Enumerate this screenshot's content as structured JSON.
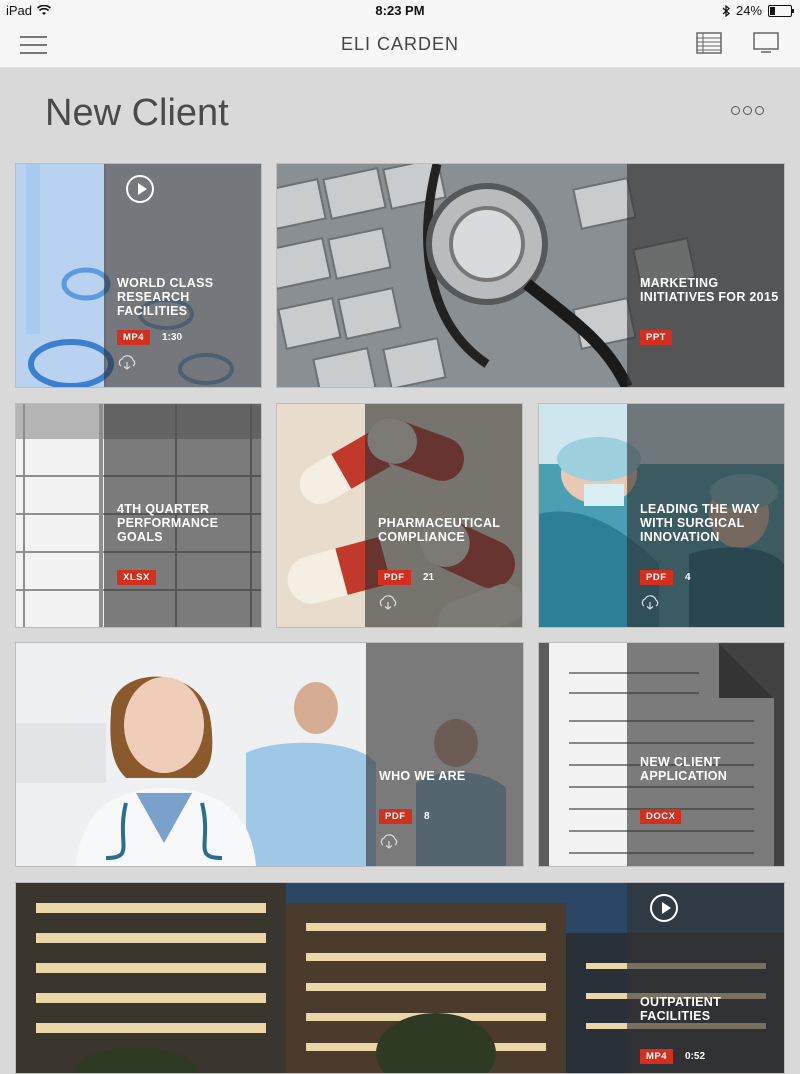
{
  "status_bar": {
    "device": "iPad",
    "time": "8:23 PM",
    "battery": "24%",
    "battery_level": 0.24
  },
  "nav": {
    "title": "ELI CARDEN",
    "menu_icon": "hamburger-menu-icon",
    "list_icon": "list-view-icon",
    "screen_icon": "monitor-icon"
  },
  "page": {
    "title": "New Client"
  },
  "tiles": [
    {
      "title_line1": "WORLD CLASS",
      "title_line2": "RESEARCH FACILITIES",
      "type": "MP4",
      "meta": "1:30"
    },
    {
      "title_line1": "MARKETING",
      "title_line2": "INITIATIVES FOR 2015",
      "type": "PPT",
      "meta": ""
    },
    {
      "title_line1": "4TH QUARTER",
      "title_line2": "PERFORMANCE",
      "title_line3": "GOALS",
      "type": "XLSX",
      "meta": ""
    },
    {
      "title_line1": "PHARMACEUTICAL",
      "title_line2": "COMPLIANCE",
      "type": "PDF",
      "meta": "21"
    },
    {
      "title_line1": "LEADING THE WAY",
      "title_line2": "WITH SURGICAL",
      "title_line3": "INNOVATION",
      "type": "PDF",
      "meta": "4"
    },
    {
      "title_line1": "WHO WE ARE",
      "type": "PDF",
      "meta": "8"
    },
    {
      "title_line1": "NEW CLIENT",
      "title_line2": "APPLICATION",
      "type": "DOCX",
      "meta": ""
    },
    {
      "title_line1": "OUTPATIENT",
      "title_line2": "FACILITIES",
      "type": "MP4",
      "meta": "0:52"
    }
  ],
  "colors": {
    "badge": "#d32f1f",
    "background": "#d9d9d9",
    "navbar": "#f7f7f7"
  }
}
